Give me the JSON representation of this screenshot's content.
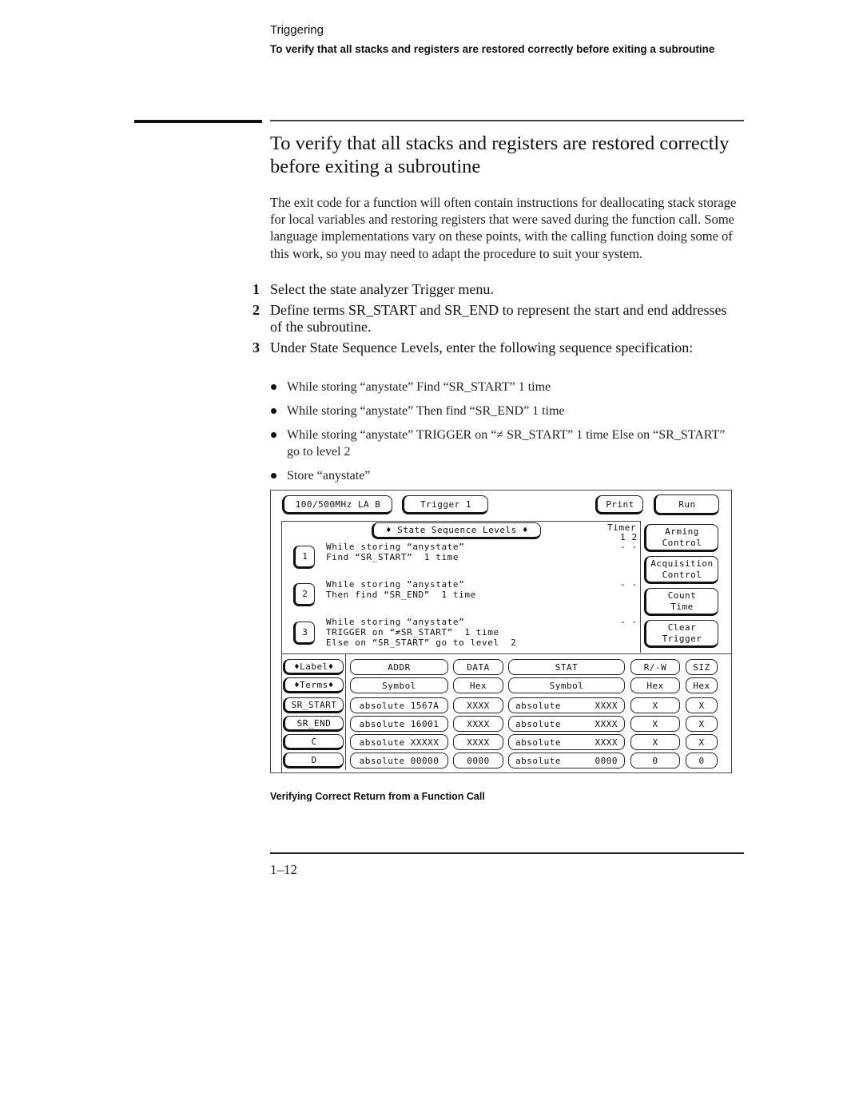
{
  "header": {
    "section": "Triggering",
    "subtitle": "To verify that all stacks and registers are restored correctly before exiting a subroutine"
  },
  "title": "To verify that all stacks and registers are restored correctly before exiting a subroutine",
  "intro": "The exit code for a function will often contain instructions for deallocating stack storage for local variables and restoring registers that were saved during the function call. Some language implementations vary on these points, with the calling function doing some of this work, so you may need to adapt the procedure to suit your system.",
  "steps": [
    {
      "num": "1",
      "text": "Select the state analyzer Trigger menu."
    },
    {
      "num": "2",
      "text": "Define terms SR_START and SR_END to represent the start and end addresses of the subroutine."
    },
    {
      "num": "3",
      "text": "Under State Sequence Levels, enter the following sequence specification:"
    }
  ],
  "bullets": [
    "While storing “anystate” Find “SR_START” 1 time",
    "While storing “anystate” Then find “SR_END” 1 time",
    "While storing “anystate” TRIGGER on “≠ SR_START” 1 time Else on “SR_START” go to level 2",
    "Store “anystate”"
  ],
  "screen": {
    "top_bar": {
      "analyzer": "100/500MHz LA B",
      "menu": "Trigger 1",
      "print": "Print",
      "run": "Run"
    },
    "sequence": {
      "header": "♦ State Sequence Levels ♦",
      "timer_label": "Timer",
      "timer_cols": "1 2",
      "levels": [
        {
          "num": "1",
          "line1": "While storing “anystate”",
          "line2": "Find “SR_START”  1 time",
          "line3": "",
          "timer": "- -"
        },
        {
          "num": "2",
          "line1": "While storing “anystate”",
          "line2": "Then find “SR_END”  1 time",
          "line3": "",
          "timer": "- -"
        },
        {
          "num": "3",
          "line1": "While storing “anystate”",
          "line2": "TRIGGER on “≠SR_START”  1 time",
          "line3": "Else on “SR_START” go to level  2",
          "timer": "- -"
        }
      ]
    },
    "side_buttons": [
      {
        "line1": "Arming",
        "line2": "Control"
      },
      {
        "line1": "Acquisition",
        "line2": "Control"
      },
      {
        "line1": "Count",
        "line2": "Time"
      },
      {
        "line1": "Clear",
        "line2": "Trigger"
      }
    ],
    "terms": {
      "label_selector": "♦Label♦",
      "terms_selector": "♦Terms♦",
      "columns": [
        "ADDR",
        "DATA",
        "STAT",
        "R/-W",
        "SIZ"
      ],
      "formats": [
        "Symbol",
        "Hex",
        "Symbol",
        "Hex",
        "Hex"
      ],
      "rows": [
        {
          "name": "SR_START",
          "addr": "absolute 1567A",
          "data": "XXXX",
          "stat_mode": "absolute",
          "stat_val": "XXXX",
          "rw": "X",
          "siz": "X"
        },
        {
          "name": "SR_END",
          "addr": "absolute 16001",
          "data": "XXXX",
          "stat_mode": "absolute",
          "stat_val": "XXXX",
          "rw": "X",
          "siz": "X"
        },
        {
          "name": "C",
          "addr": "absolute XXXXX",
          "data": "XXXX",
          "stat_mode": "absolute",
          "stat_val": "XXXX",
          "rw": "X",
          "siz": "X"
        },
        {
          "name": "D",
          "addr": "absolute 00000",
          "data": "0000",
          "stat_mode": "absolute",
          "stat_val": "0000",
          "rw": "0",
          "siz": "0"
        }
      ]
    }
  },
  "figure_caption": "Verifying Correct Return from a Function Call",
  "page_number": "1–12"
}
